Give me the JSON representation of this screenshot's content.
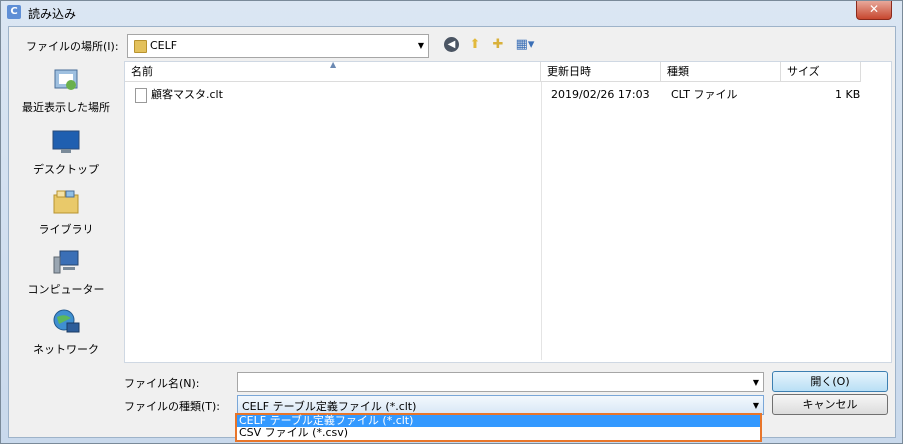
{
  "window": {
    "title": "読み込み",
    "close_label": "✕"
  },
  "toolbar": {
    "lookin_label": "ファイルの場所(I):",
    "lookin_value": "CELF"
  },
  "places": [
    {
      "label": "最近表示した場所",
      "icon": "recent-places-icon"
    },
    {
      "label": "デスクトップ",
      "icon": "desktop-icon"
    },
    {
      "label": "ライブラリ",
      "icon": "libraries-icon"
    },
    {
      "label": "コンピューター",
      "icon": "computer-icon"
    },
    {
      "label": "ネットワーク",
      "icon": "network-icon"
    }
  ],
  "filelist": {
    "columns": [
      "名前",
      "更新日時",
      "種類",
      "サイズ"
    ],
    "rows": [
      {
        "name": "顧客マスタ.clt",
        "modified": "2019/02/26 17:03",
        "type": "CLT ファイル",
        "size": "1 KB"
      }
    ]
  },
  "bottom": {
    "filename_label": "ファイル名(N):",
    "filename_value": "",
    "filetype_label": "ファイルの種類(T):",
    "filetype_value": "CELF テーブル定義ファイル (*.clt)",
    "open_label": "開く(O)",
    "cancel_label": "キャンセル"
  },
  "dropdown_options": [
    "CELF テーブル定義ファイル (*.clt)",
    "CSV ファイル (*.csv)"
  ],
  "colors": {
    "highlight": "#3399ff",
    "dropdown_border": "#e8752a"
  }
}
